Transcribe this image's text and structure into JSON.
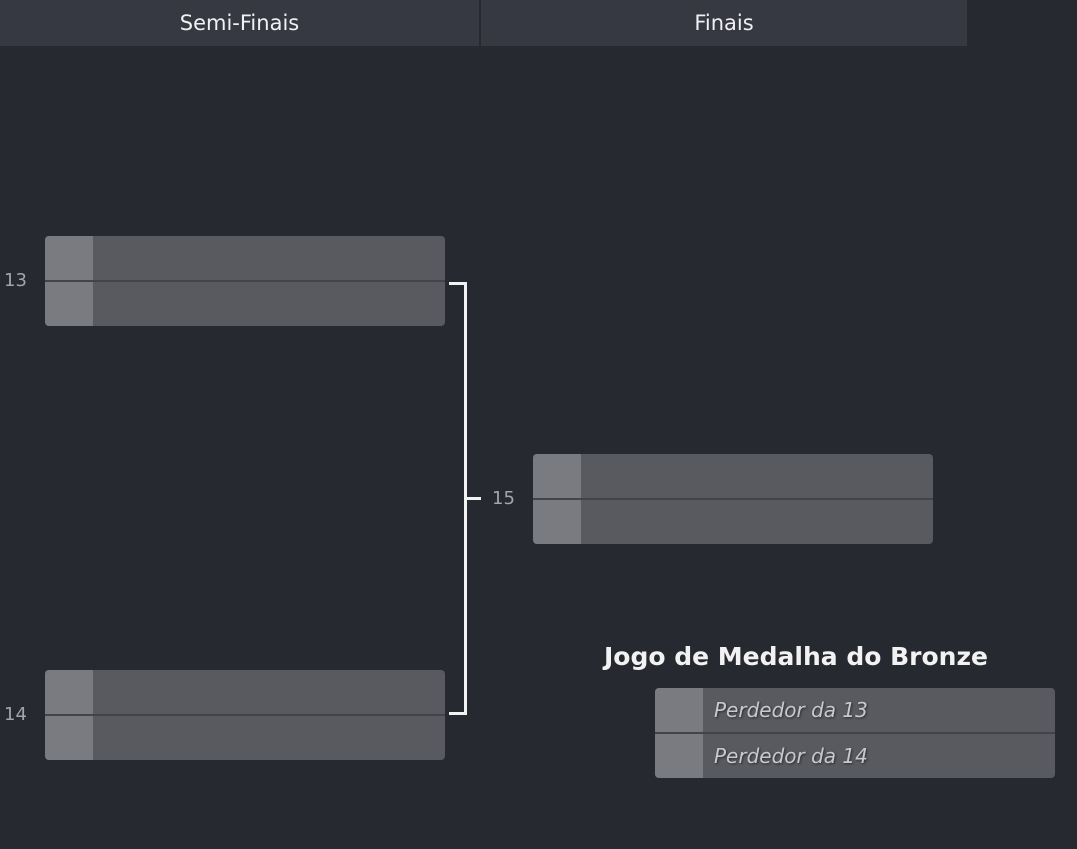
{
  "rounds": {
    "semi_label": "Semi-Finais",
    "final_label": "Finais"
  },
  "matches": {
    "m13": {
      "number": "13",
      "top": "",
      "bottom": ""
    },
    "m14": {
      "number": "14",
      "top": "",
      "bottom": ""
    },
    "m15": {
      "number": "15",
      "top": "",
      "bottom": ""
    }
  },
  "bronze": {
    "title": "Jogo de Medalha do Bronze",
    "top": "Perdedor da 13",
    "bottom": "Perdedor da 14"
  }
}
